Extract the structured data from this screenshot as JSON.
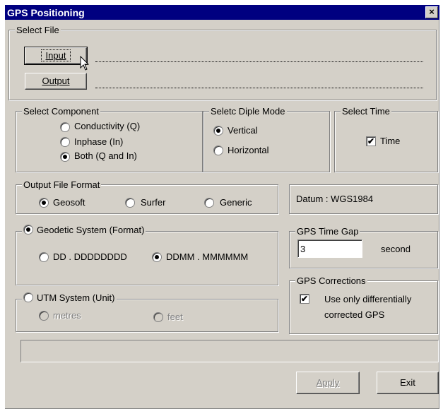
{
  "window": {
    "title": "GPS Positioning",
    "close_label": "×"
  },
  "select_file": {
    "legend": "Select File",
    "input_label": "Input",
    "output_label": "Output"
  },
  "component": {
    "legend": "Select Component",
    "options": [
      {
        "label": "Conductivity (Q)",
        "checked": false
      },
      {
        "label": "Inphase (In)",
        "checked": false
      },
      {
        "label": "Both (Q and In)",
        "checked": true
      }
    ]
  },
  "dipole_mode": {
    "legend": "Seletc Diple Mode",
    "options": [
      {
        "label": "Vertical",
        "checked": true
      },
      {
        "label": "Horizontal",
        "checked": false
      }
    ]
  },
  "select_time": {
    "legend": "Select Time",
    "time_label": "Time",
    "checked": true
  },
  "output_format": {
    "legend": "Output File Format",
    "options": [
      {
        "label": "Geosoft",
        "checked": true
      },
      {
        "label": "Surfer",
        "checked": false
      },
      {
        "label": "Generic",
        "checked": false
      }
    ]
  },
  "datum": {
    "text": "Datum : WGS1984"
  },
  "geodetic": {
    "legend": "Geodetic System (Format)",
    "checked": true,
    "options": [
      {
        "label": "DD . DDDDDDDD",
        "checked": false
      },
      {
        "label": "DDMM . MMMMMM",
        "checked": true
      }
    ]
  },
  "time_gap": {
    "legend": "GPS Time Gap",
    "value": "3",
    "unit": "second"
  },
  "utm": {
    "legend": "UTM System (Unit)",
    "checked": false,
    "options": [
      {
        "label": "metres",
        "checked": false
      },
      {
        "label": "feet",
        "checked": false
      }
    ]
  },
  "corrections": {
    "legend": "GPS Corrections",
    "line1": "Use only differentially",
    "line2": "corrected GPS",
    "checked": true
  },
  "buttons": {
    "apply": "Apply",
    "exit": "Exit"
  }
}
